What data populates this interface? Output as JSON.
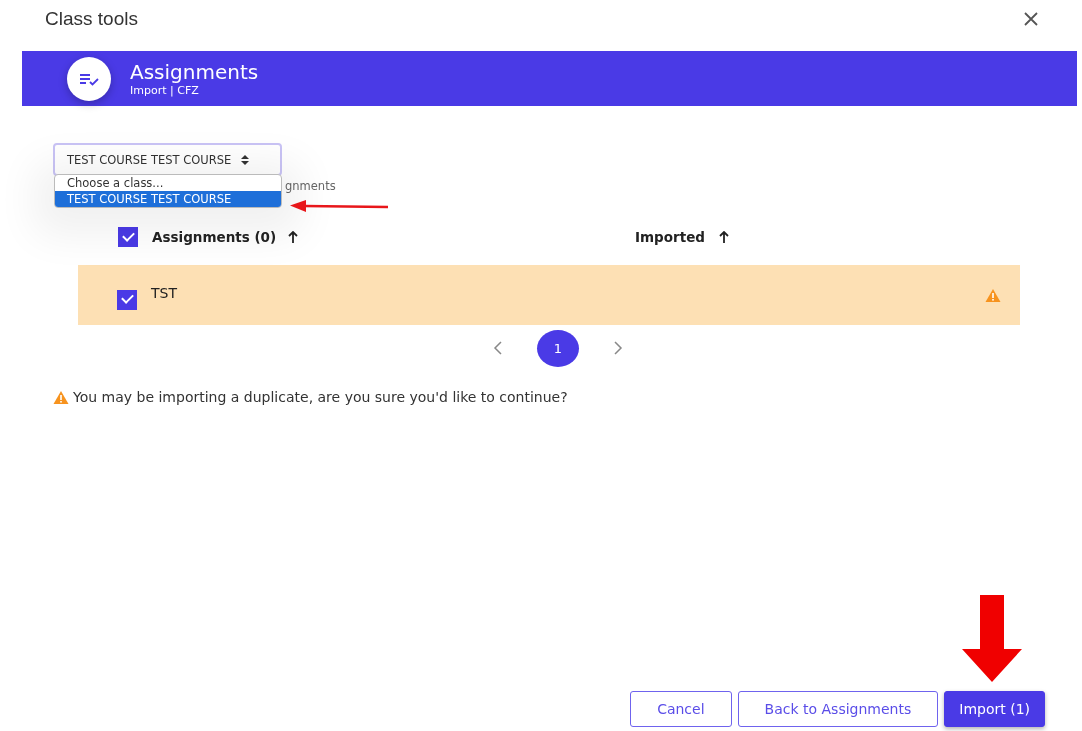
{
  "dialog": {
    "title": "Class tools"
  },
  "banner": {
    "title": "Assignments",
    "subtitle": "Import | CFZ"
  },
  "class_select": {
    "value": "TEST COURSE TEST COURSE",
    "expanded": true,
    "options": [
      {
        "label": "Choose a class...",
        "selected": false
      },
      {
        "label": "TEST COURSE TEST COURSE",
        "selected": true
      }
    ]
  },
  "partial_label": "gnments",
  "table": {
    "header_checked": true,
    "columns": [
      {
        "label": "Assignments (0)"
      },
      {
        "label": "Imported"
      }
    ],
    "rows": [
      {
        "name": "TST",
        "checked": true,
        "warning": true
      }
    ]
  },
  "pagination": {
    "pages": [
      {
        "label": "1",
        "selected": true
      }
    ]
  },
  "warning": "You may be importing a duplicate, are you sure you'd like to continue?",
  "buttons": [
    {
      "label": "Cancel",
      "kind": "outline"
    },
    {
      "label": "Back to Assignments",
      "kind": "outline"
    },
    {
      "label": "Import (1)",
      "kind": "primary"
    }
  ]
}
